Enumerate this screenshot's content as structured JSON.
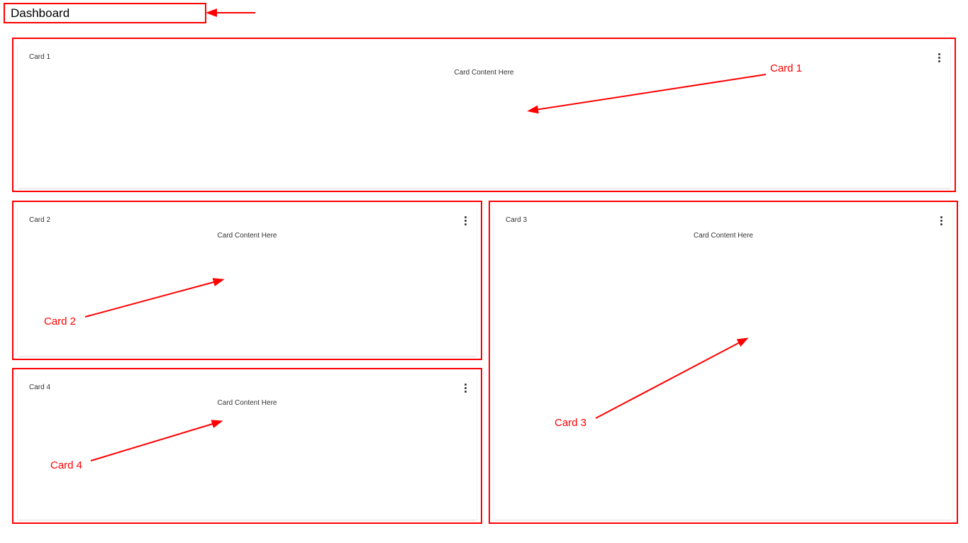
{
  "title": "Dashboard",
  "cards": [
    {
      "title": "Card 1",
      "content": "Card Content Here",
      "annotation": "Card 1"
    },
    {
      "title": "Card 2",
      "content": "Card Content Here",
      "annotation": "Card 2"
    },
    {
      "title": "Card 3",
      "content": "Card Content Here",
      "annotation": "Card 3"
    },
    {
      "title": "Card 4",
      "content": "Card Content Here",
      "annotation": "Card 4"
    }
  ],
  "colors": {
    "annotation": "#ff0000",
    "text": "#333333"
  }
}
